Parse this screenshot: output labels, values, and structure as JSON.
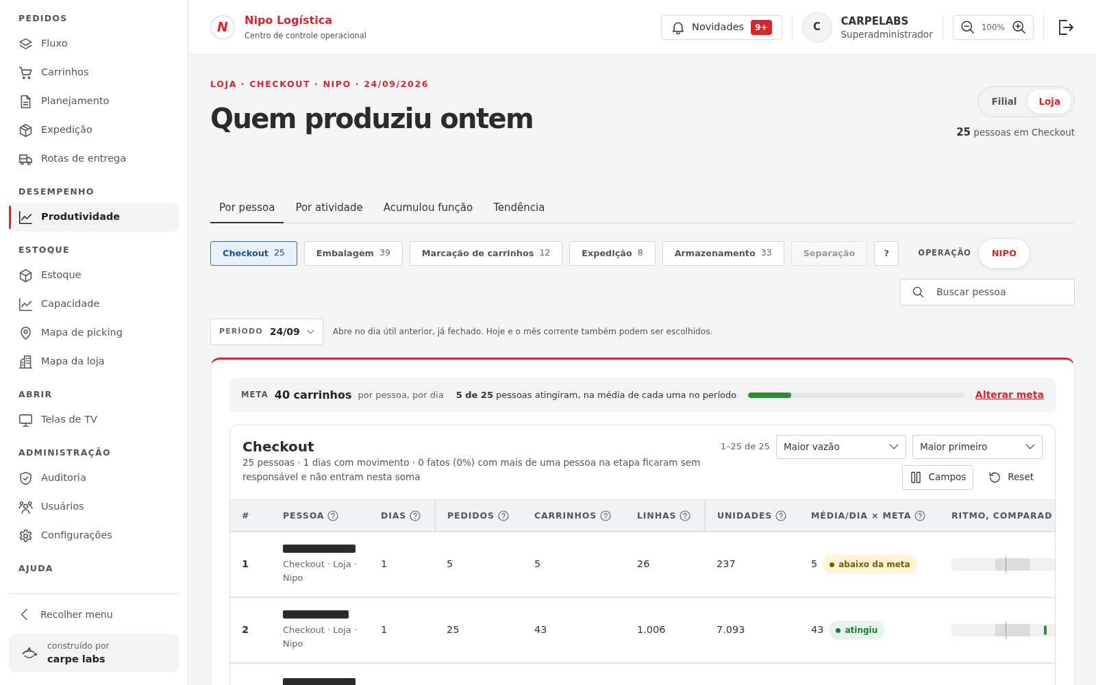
{
  "sidebar": {
    "sections": [
      {
        "heading": "PEDIDOS",
        "items": [
          {
            "label": "Fluxo",
            "selected": false
          },
          {
            "label": "Carrinhos",
            "selected": false
          },
          {
            "label": "Planejamento",
            "selected": false
          },
          {
            "label": "Expedição",
            "selected": false
          },
          {
            "label": "Rotas de entrega",
            "selected": false
          }
        ]
      },
      {
        "heading": "DESEMPENHO",
        "items": [
          {
            "label": "Produtividade",
            "selected": true
          }
        ]
      },
      {
        "heading": "ESTOQUE",
        "items": [
          {
            "label": "Estoque",
            "selected": false
          },
          {
            "label": "Capacidade",
            "selected": false
          },
          {
            "label": "Mapa de picking",
            "selected": false
          },
          {
            "label": "Mapa da loja",
            "selected": false
          }
        ]
      },
      {
        "heading": "ABRIR",
        "items": [
          {
            "label": "Telas de TV",
            "selected": false
          }
        ]
      },
      {
        "heading": "ADMINISTRAÇÃO",
        "items": [
          {
            "label": "Auditoria",
            "selected": false
          },
          {
            "label": "Usuários",
            "selected": false
          },
          {
            "label": "Configurações",
            "selected": false
          }
        ]
      },
      {
        "heading": "AJUDA"
      }
    ],
    "collapse": "Recolher menu",
    "credit": {
      "caption": "construído por",
      "name": "carpe labs"
    }
  },
  "header": {
    "brand": {
      "logo_letter": "N",
      "name": "Nipo Logística",
      "tagline": "Centro de controle operacional"
    },
    "news": {
      "label": "Novidades",
      "badge": "9+"
    },
    "user": {
      "initial": "C",
      "name": "CARPELABS",
      "role": "Superadministrador"
    },
    "zoom": "100%"
  },
  "page": {
    "breadcrumb": "LOJA · CHECKOUT · NIPO · 24/09/2026",
    "title": "Quem produziu ontem",
    "scope": [
      {
        "label": "Filial",
        "selected": false
      },
      {
        "label": "Loja",
        "selected": true
      }
    ],
    "count": "**25** pessoas em Checkout"
  },
  "tabs": [
    {
      "label": "Por pessoa",
      "selected": true
    },
    {
      "label": "Por atividade",
      "selected": false
    },
    {
      "label": "Acumulou função",
      "selected": false
    },
    {
      "label": "Tendência",
      "selected": false
    }
  ],
  "filters": {
    "chips": [
      {
        "label": "Checkout",
        "count": "25",
        "selected": true,
        "disabled": false
      },
      {
        "label": "Embalagem",
        "count": "39",
        "selected": false,
        "disabled": false
      },
      {
        "label": "Marcação de carrinhos",
        "count": "12",
        "selected": false,
        "disabled": false
      },
      {
        "label": "Expedição",
        "count": "8",
        "selected": false,
        "disabled": false
      },
      {
        "label": "Armazenamento",
        "count": "33",
        "selected": false,
        "disabled": false
      },
      {
        "label": "Separação",
        "selected": false,
        "disabled": true
      }
    ],
    "help": "?",
    "operation": {
      "label": "OPERAÇÃO",
      "value": "NIPO"
    },
    "search": {
      "placeholder": "Buscar pessoa"
    }
  },
  "period": {
    "label": "PERÍODO",
    "value": "24/09",
    "hint": "Abre no dia útil anterior, já fechado. Hoje e o mês corrente também podem ser escolhidos."
  },
  "meta": {
    "label": "META",
    "value": "40 carrinhos",
    "unit": "por pessoa, por dia",
    "summary": "**5 de 25** pessoas atingiram, na média de cada uma no período",
    "level": 0.2,
    "action": "Alterar meta"
  },
  "table": {
    "title": "Checkout",
    "range": "1–25 de 25",
    "sort_field": "Maior vazão",
    "sort_order": "Maior primeiro",
    "description": "25 pessoas · 1 dias com movimento · 0 fatos (0%) com mais de uma pessoa na etapa ficaram sem responsável e não entram nesta soma",
    "fields_button": "Campos",
    "reset_button": "Reset",
    "columns": [
      {
        "label": "#",
        "help": false
      },
      {
        "label": "PESSOA",
        "help": true
      },
      {
        "label": "DIAS",
        "help": true
      },
      {
        "label": "PEDIDOS",
        "help": true
      },
      {
        "label": "CARRINHOS",
        "help": true
      },
      {
        "label": "LINHAS",
        "help": true
      },
      {
        "label": "UNIDADES",
        "help": true
      },
      {
        "label": "MÉDIA/DIA × META",
        "help": true
      },
      {
        "label": "RITMO, COMPARAD",
        "help": false
      }
    ],
    "rows": [
      {
        "kind": "full",
        "rank": "1",
        "location": "Checkout · Loja · Nipo",
        "dias": "1",
        "pedidos": "5",
        "carrinhos": "5",
        "linhas": "26",
        "unidades": "237",
        "media": "5",
        "status": {
          "kind": "below",
          "label": "abaixo da meta"
        },
        "pace_marker": false
      },
      {
        "kind": "full",
        "rank": "2",
        "location": "Checkout · Loja · Nipo",
        "dias": "1",
        "pedidos": "25",
        "carrinhos": "43",
        "linhas": "1.006",
        "unidades": "7.093",
        "media": "43",
        "status": {
          "kind": "met",
          "label": "atingiu"
        },
        "pace_marker": true
      },
      {
        "kind": "cut"
      }
    ]
  }
}
